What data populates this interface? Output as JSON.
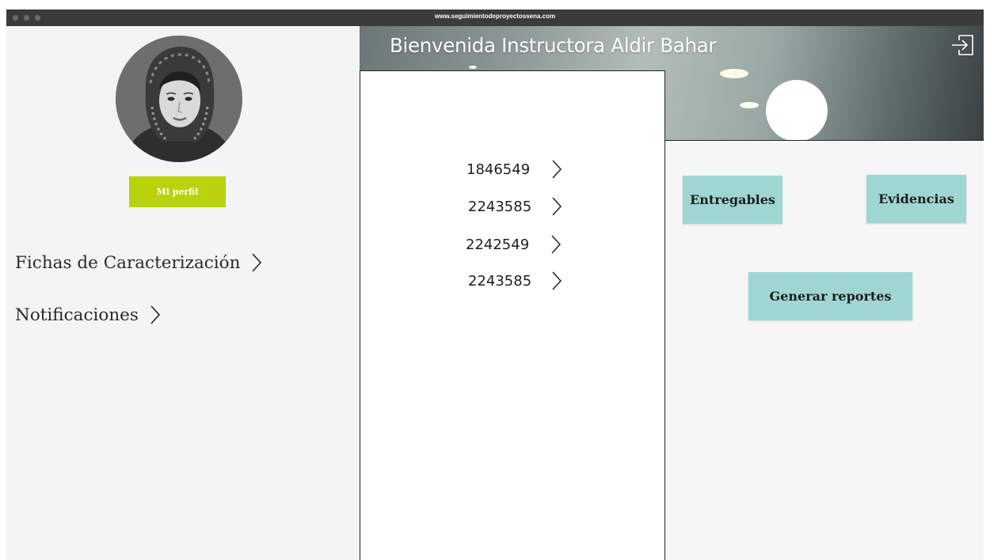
{
  "browser": {
    "url": "www.seguimientodeproyectossena.com"
  },
  "sidebar": {
    "avatar_icon": "user-avatar",
    "profile_button": "Mi perfil",
    "nav": [
      {
        "label": "Fichas de Caracterización",
        "icon": "chevron-right-icon"
      },
      {
        "label": "Notificaciones",
        "icon": "chevron-right-icon"
      }
    ]
  },
  "header": {
    "welcome": "Bienvenida Instructora Aldir Bahar",
    "logout_icon": "logout-icon"
  },
  "fichas": [
    {
      "number": "1846549"
    },
    {
      "number": "2243585"
    },
    {
      "number": "2242549"
    },
    {
      "number": "2243585"
    }
  ],
  "actions": {
    "entregables": "Entregables",
    "evidencias": "Evidencias",
    "reportes": "Generar reportes"
  },
  "colors": {
    "profile_button": "#b9d20c",
    "action_button": "#a0d6d2",
    "chrome": "#3b3b3b"
  }
}
